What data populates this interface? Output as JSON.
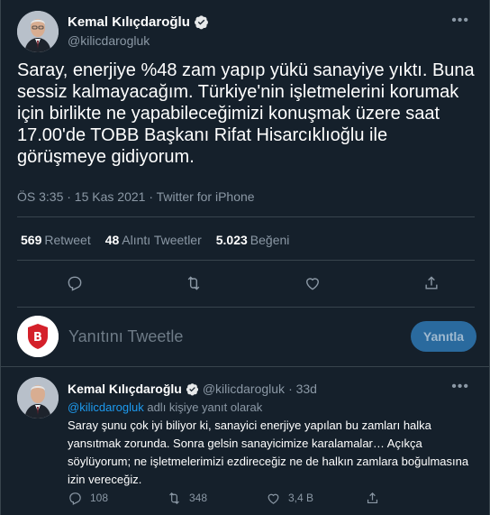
{
  "main_tweet": {
    "author_name": "Kemal Kılıçdaroğlu",
    "author_handle": "@kilicdarogluk",
    "text": "Saray, enerjiye %48 zam yapıp yükü sanayiye yıktı. Buna sessiz kalmayacağım. Türkiye'nin işletmelerini korumak için birlikte ne yapabileceğimizi konuşmak üzere saat 17.00'de TOBB Başkanı Rifat Hisarcıklıoğlu ile görüşmeye gidiyorum.",
    "meta": "ÖS 3:35 · 15 Kas 2021 · Twitter for iPhone",
    "stats": [
      {
        "count": "569",
        "label": "Retweet"
      },
      {
        "count": "48",
        "label": "Alıntı Tweetler"
      },
      {
        "count": "5.023",
        "label": "Beğeni"
      }
    ]
  },
  "composer": {
    "placeholder": "Yanıtını Tweetle",
    "reply_button": "Yanıtla"
  },
  "reply_tweet": {
    "author_name": "Kemal Kılıçdaroğlu",
    "author_handle": "@kilicdarogluk",
    "time": "· 33d",
    "replying_mention": "@kilicdarogluk",
    "replying_suffix": " adlı kişiye yanıt olarak",
    "text": "Saray şunu çok iyi biliyor ki, sanayici enerjiye yapılan bu zamları halka yansıtmak zorunda. Sonra gelsin sanayicimize karalamalar… Açıkça söylüyorum; ne işletmelerimizi ezdireceğiz ne de halkın zamlara boğulmasına izin vereceğiz.",
    "replies": "108",
    "retweets": "348",
    "likes": "3,4 B"
  },
  "colors": {
    "background": "#15202b",
    "accent": "#1d9bf0",
    "muted": "#8b98a5"
  },
  "icons": [
    "verified-badge-icon",
    "more-icon",
    "reply-icon",
    "retweet-icon",
    "like-icon",
    "share-icon"
  ]
}
